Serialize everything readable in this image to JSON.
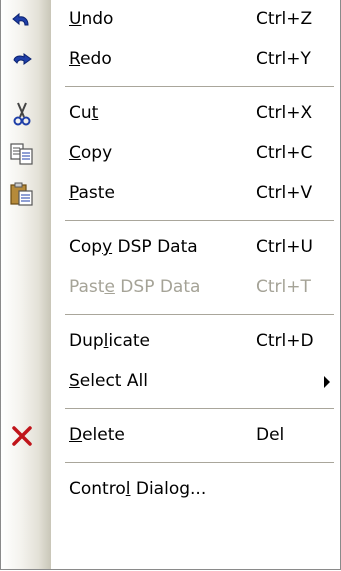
{
  "menu": {
    "items": [
      {
        "type": "item",
        "name": "undo",
        "icon": "undo-arrow-icon",
        "pre": "",
        "key": "U",
        "post": "ndo",
        "shortcut": "Ctrl+Z",
        "enabled": true
      },
      {
        "type": "item",
        "name": "redo",
        "icon": "redo-arrow-icon",
        "pre": "",
        "key": "R",
        "post": "edo",
        "shortcut": "Ctrl+Y",
        "enabled": true
      },
      {
        "type": "separator"
      },
      {
        "type": "item",
        "name": "cut",
        "icon": "scissors-icon",
        "pre": "Cu",
        "key": "t",
        "post": "",
        "shortcut": "Ctrl+X",
        "enabled": true
      },
      {
        "type": "item",
        "name": "copy",
        "icon": "copy-documents-icon",
        "pre": "",
        "key": "C",
        "post": "opy",
        "shortcut": "Ctrl+C",
        "enabled": true
      },
      {
        "type": "item",
        "name": "paste",
        "icon": "clipboard-paste-icon",
        "pre": "",
        "key": "P",
        "post": "aste",
        "shortcut": "Ctrl+V",
        "enabled": true
      },
      {
        "type": "separator"
      },
      {
        "type": "item",
        "name": "copy-dsp-data",
        "icon": "",
        "pre": "Cop",
        "key": "y",
        "post": " DSP Data",
        "shortcut": "Ctrl+U",
        "enabled": true
      },
      {
        "type": "item",
        "name": "paste-dsp-data",
        "icon": "",
        "pre": "Past",
        "key": "e",
        "post": " DSP Data",
        "shortcut": "Ctrl+T",
        "enabled": false
      },
      {
        "type": "separator"
      },
      {
        "type": "item",
        "name": "duplicate",
        "icon": "",
        "pre": "Dup",
        "key": "l",
        "post": "icate",
        "shortcut": "Ctrl+D",
        "enabled": true
      },
      {
        "type": "item",
        "name": "select-all",
        "icon": "",
        "pre": "",
        "key": "S",
        "post": "elect All",
        "shortcut": "",
        "enabled": true,
        "submenu": true
      },
      {
        "type": "separator"
      },
      {
        "type": "item",
        "name": "delete",
        "icon": "red-x-delete-icon",
        "pre": "",
        "key": "D",
        "post": "elete",
        "shortcut": "Del",
        "enabled": true
      },
      {
        "type": "separator"
      },
      {
        "type": "item",
        "name": "control-dialog",
        "icon": "",
        "pre": "Contro",
        "key": "l",
        "post": " Dialog...",
        "shortcut": "",
        "enabled": true
      }
    ]
  },
  "colors": {
    "text": "#000000",
    "disabled_text": "#a5a397",
    "separator": "#a9a69b",
    "delete_icon": "#c0151b"
  }
}
